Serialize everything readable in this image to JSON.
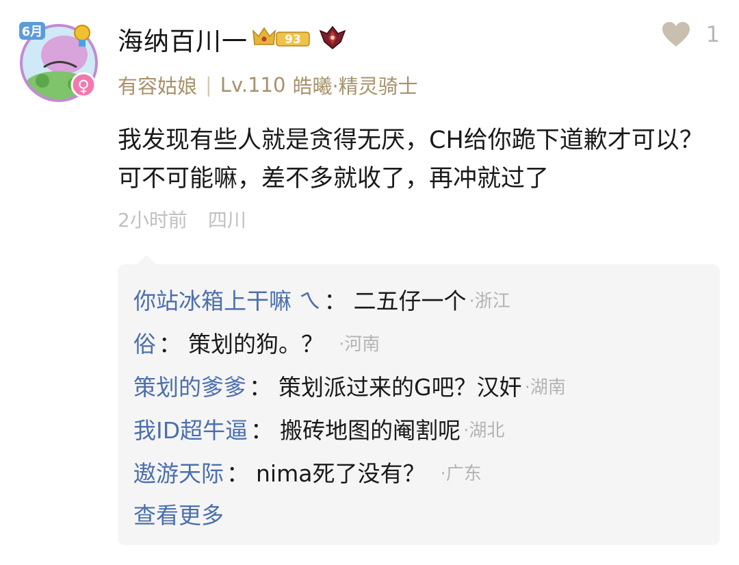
{
  "comment": {
    "username": "海纳百川一",
    "vip_badge_text": "93",
    "meta": {
      "title": "有容姑娘",
      "level": "Lv.110",
      "rank": "皓曦·精灵骑士"
    },
    "text": "我发现有些人就是贪得无厌，CH给你跪下道歉才可以？可不可能嘛，差不多就收了，再冲就过了",
    "time": "2小时前",
    "location": "四川",
    "like_count": "1",
    "avatar_month_label": "6月",
    "avatar_gender_icon": "female-icon",
    "colors": {
      "username_link": "#4b6fad",
      "meta_gold": "#a7916a",
      "reply_bg": "#f5f5f5",
      "badge_gold": "#e0b030"
    }
  },
  "replies": [
    {
      "user": "你站冰箱上干嘛 ㄟ",
      "text": "二五仔一个",
      "location": "·浙江"
    },
    {
      "user": "俗",
      "text": "策划的狗。？",
      "location": "·河南"
    },
    {
      "user": "策划的爹爹",
      "text": "策划派过来的G吧？汉奸",
      "location": "·湖南"
    },
    {
      "user": "我ID超牛逼",
      "text": "搬砖地图的阉割呢",
      "location": "·湖北"
    },
    {
      "user": "遨游天际",
      "text": "nima死了没有？",
      "location": "·广东"
    }
  ],
  "colon": "：",
  "view_more": "查看更多"
}
